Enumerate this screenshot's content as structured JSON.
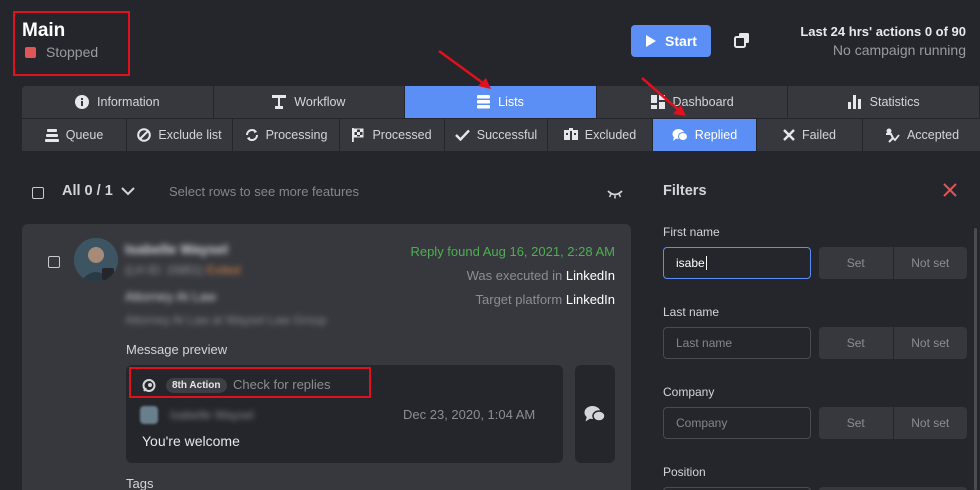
{
  "header": {
    "title": "Main",
    "status": "Stopped",
    "start_label": "Start",
    "actions_line": "Last 24 hrs' actions 0 of 90",
    "campaign_line": "No campaign running"
  },
  "tabs": [
    {
      "label": "Information",
      "icon": "info-icon"
    },
    {
      "label": "Workflow",
      "icon": "workflow-icon"
    },
    {
      "label": "Lists",
      "icon": "list-icon",
      "active": true
    },
    {
      "label": "Dashboard",
      "icon": "dashboard-icon"
    },
    {
      "label": "Statistics",
      "icon": "bar-chart-icon"
    }
  ],
  "subtabs": [
    {
      "label": "Queue",
      "icon": "queue-icon"
    },
    {
      "label": "Exclude list",
      "icon": "block-icon"
    },
    {
      "label": "Processing",
      "icon": "sync-icon"
    },
    {
      "label": "Processed",
      "icon": "flag-icon"
    },
    {
      "label": "Successful",
      "icon": "check-icon"
    },
    {
      "label": "Excluded",
      "icon": "excluded-icon"
    },
    {
      "label": "Replied",
      "icon": "chat-icon",
      "active": true
    },
    {
      "label": "Failed",
      "icon": "x-icon"
    },
    {
      "label": "Accepted",
      "icon": "accepted-icon"
    }
  ],
  "list": {
    "all_label": "All 0 / 1",
    "hint": "Select rows to see more features"
  },
  "card": {
    "name": "Isabelle Waysel",
    "id_line": "(LH ID: 15851)",
    "id_badge": "Exited",
    "headline": "Attorney At Law",
    "sub_headline": "Attorney At Law at Waysel Law Group",
    "reply_found": "Reply found Aug 16, 2021, 2:28 AM",
    "executed_prefix": "Was executed in",
    "executed_platform": "LinkedIn",
    "target_prefix": "Target platform",
    "target_platform": "LinkedIn",
    "message_preview_label": "Message preview",
    "action_badge": "8th Action",
    "action_name": "Check for replies",
    "msg_sender": "Isabelle Waysel",
    "msg_date": "Dec 23, 2020, 1:04 AM",
    "msg_text": "You're welcome",
    "tags_label": "Tags"
  },
  "filters": {
    "title": "Filters",
    "set_label": "Set",
    "not_set_label": "Not set",
    "fields": [
      {
        "label": "First name",
        "value": "isabe",
        "placeholder": ""
      },
      {
        "label": "Last name",
        "value": "",
        "placeholder": "Last name"
      },
      {
        "label": "Company",
        "value": "",
        "placeholder": "Company"
      },
      {
        "label": "Position",
        "value": "",
        "placeholder": ""
      }
    ]
  },
  "colors": {
    "accent": "#5b8ff5",
    "background": "#25262b",
    "panel": "#37383e",
    "stopped": "#e05555",
    "reply_found": "#4caf50",
    "annotation": "#e0101c"
  }
}
